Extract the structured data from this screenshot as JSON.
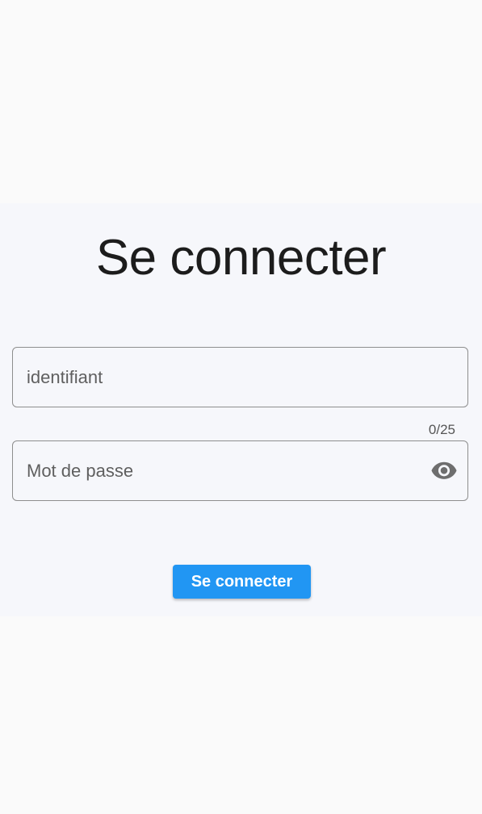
{
  "login": {
    "title": "Se connecter",
    "username": {
      "placeholder": "identifiant",
      "counter": "0/25"
    },
    "password": {
      "placeholder": "Mot de passe",
      "toggle_icon": "eye-icon"
    },
    "submit_label": "Se connecter"
  },
  "colors": {
    "background": "#fafafa",
    "panel": "#f6f7fb",
    "accent": "#2196f3",
    "field_border": "#8e8e8e"
  }
}
